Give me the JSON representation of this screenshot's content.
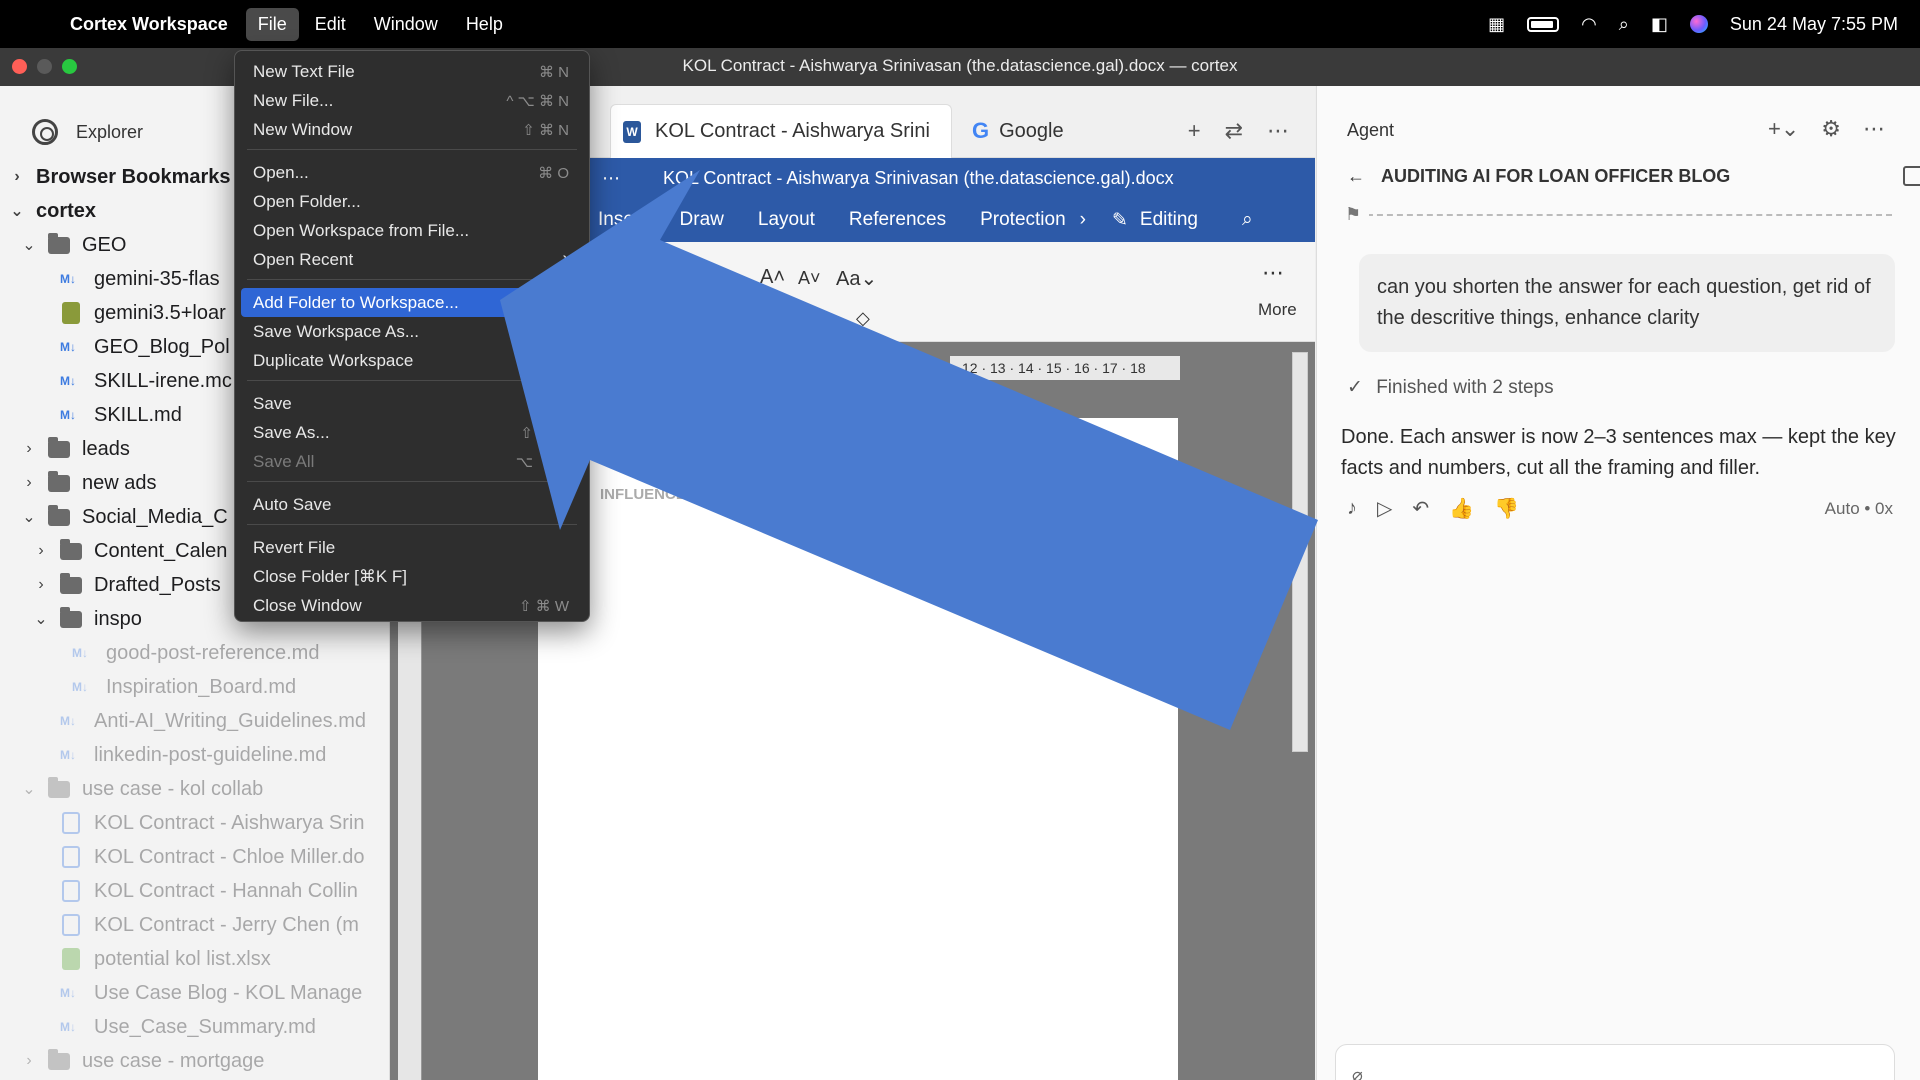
{
  "menubar": {
    "app_name": "Cortex Workspace",
    "menus": [
      "File",
      "Edit",
      "Window",
      "Help"
    ],
    "datetime": "Sun 24 May  7:55 PM"
  },
  "window": {
    "title": "KOL Contract - Aishwarya Srinivasan (the.datascience.gal).docx — cortex"
  },
  "file_menu": {
    "items": [
      {
        "label": "New Text File",
        "shortcut": "⌘ N"
      },
      {
        "label": "New File...",
        "shortcut": "^ ⌥ ⌘ N"
      },
      {
        "label": "New Window",
        "shortcut": "⇧ ⌘ N"
      },
      {
        "label": "Open...",
        "shortcut": "⌘ O"
      },
      {
        "label": "Open Folder...",
        "shortcut": ""
      },
      {
        "label": "Open Workspace from File...",
        "shortcut": ""
      },
      {
        "label": "Open Recent",
        "shortcut": "›"
      },
      {
        "label": "Add Folder to Workspace...",
        "shortcut": ""
      },
      {
        "label": "Save Workspace As...",
        "shortcut": ""
      },
      {
        "label": "Duplicate Workspace",
        "shortcut": ""
      },
      {
        "label": "Save",
        "shortcut": ""
      },
      {
        "label": "Save As...",
        "shortcut": "⇧"
      },
      {
        "label": "Save All",
        "shortcut": "⌥"
      },
      {
        "label": "Auto Save",
        "shortcut": ""
      },
      {
        "label": "Revert File",
        "shortcut": ""
      },
      {
        "label": "Close Folder [⌘K F]",
        "shortcut": ""
      },
      {
        "label": "Close Window",
        "shortcut": "⇧ ⌘ W"
      }
    ]
  },
  "sidebar": {
    "title": "Explorer",
    "sections": [
      "Browser Bookmarks",
      "cortex"
    ],
    "tree": [
      "GEO",
      "gemini-35-flas",
      "gemini3.5+loar",
      "GEO_Blog_Pol",
      "SKILL-irene.mc",
      "SKILL.md",
      "leads",
      "new ads",
      "Social_Media_C",
      "Content_Calen",
      "Drafted_Posts",
      "inspo",
      "good-post-reference.md",
      "Inspiration_Board.md",
      "Anti-AI_Writing_Guidelines.md",
      "linkedin-post-guideline.md",
      "use case - kol collab",
      "KOL Contract - Aishwarya Srin",
      "KOL Contract - Chloe Miller.do",
      "KOL Contract - Hannah Collin",
      "KOL Contract - Jerry Chen (m",
      "potential kol list.xlsx",
      "Use Case Blog - KOL Manage",
      "Use_Case_Summary.md",
      "use case - mortgage"
    ]
  },
  "tabs": {
    "doc_tab": "KOL Contract - Aishwarya Srini",
    "google_tab": "Google"
  },
  "word": {
    "doc_title": "KOL Contract - Aishwarya Srinivasan (the.datascience.gal).docx",
    "ribbon": [
      "Insert",
      "Draw",
      "Layout",
      "References",
      "Protection"
    ],
    "editing": "Editing",
    "more": "More",
    "ruler": "12 · 13 · 14 · 15 · 16 · 17 · 18",
    "heading": "INFLUENCER COLLAB"
  },
  "agent": {
    "title": "Agent",
    "thread": "AUDITING AI FOR LOAN OFFICER BLOG",
    "user_message": "can you shorten the answer for each question, get rid of the descritive things, enhance clarity",
    "status": "Finished with 2 steps",
    "answer": "Done. Each answer is now 2–3 sentences max — kept the key facts and numbers, cut all the framing and filler.",
    "mode": "Auto • 0x"
  },
  "colors": {
    "menu_highlight": "#2f66d5",
    "word_blue": "#2d5aa8",
    "arrow": "#4a7bd0"
  }
}
